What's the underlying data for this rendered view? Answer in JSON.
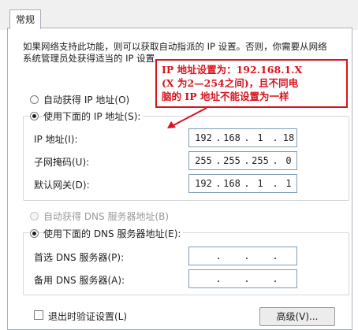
{
  "tab": {
    "label": "常规"
  },
  "intro": {
    "text": "如果网络支持此功能，则可以获取自动指派的 IP 设置。否则，你需要从网络系统管理员处获得适当的 IP 设置。"
  },
  "ip": {
    "auto_label": "自动获得 IP 地址(O)",
    "manual_label": "使用下面的 IP 地址(S):",
    "mode": "manual",
    "address": {
      "label": "IP 地址(I):",
      "octets": [
        "192",
        "168",
        "1",
        "18"
      ]
    },
    "subnet": {
      "label": "子网掩码(U):",
      "octets": [
        "255",
        "255",
        "255",
        "0"
      ]
    },
    "gateway": {
      "label": "默认网关(D):",
      "octets": [
        "192",
        "168",
        "1",
        "1"
      ]
    }
  },
  "dns": {
    "auto_label": "自动获得 DNS 服务器地址(B)",
    "manual_label": "使用下面的 DNS 服务器地址(E):",
    "mode": "manual",
    "preferred": {
      "label": "首选 DNS 服务器(P):",
      "octets": [
        "",
        "",
        "",
        ""
      ]
    },
    "alternate": {
      "label": "备用 DNS 服务器(A):",
      "octets": [
        "",
        "",
        "",
        ""
      ]
    }
  },
  "validate": {
    "label": "退出时验证设置(L)",
    "checked": false
  },
  "advanced_button": {
    "label": "高级(V)..."
  },
  "annotation": {
    "line1": "IP 地址设置为：192.168.1.X",
    "line2": "(X 为2—254之间)，且不同电",
    "line3": "脑的 IP 地址不能设置为一样",
    "color": "#d8141e"
  }
}
